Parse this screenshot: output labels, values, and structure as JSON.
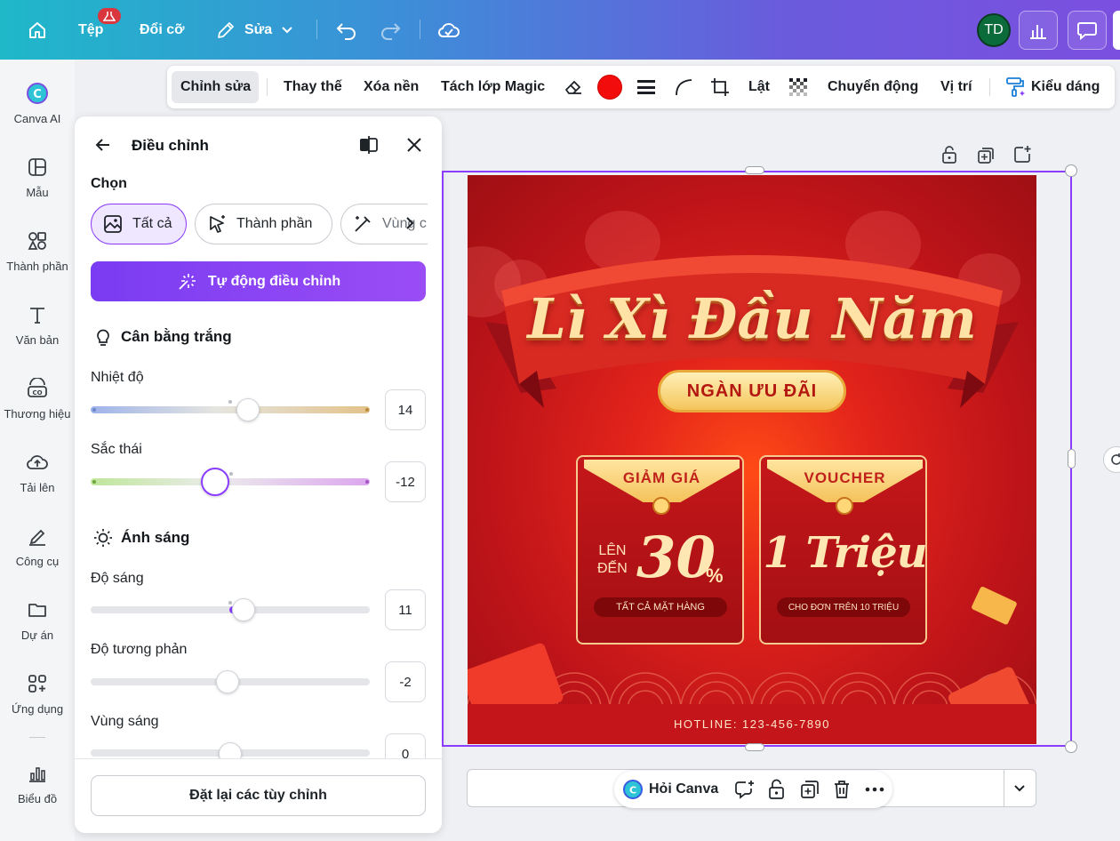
{
  "topbar": {
    "file_label": "Tệp",
    "resize_label": "Đổi cỡ",
    "edit_label": "Sửa",
    "avatar_initials": "TD"
  },
  "rail": {
    "items": [
      {
        "label": "Canva AI"
      },
      {
        "label": "Mẫu"
      },
      {
        "label": "Thành phần"
      },
      {
        "label": "Văn bản"
      },
      {
        "label": "Thương hiệu"
      },
      {
        "label": "Tải lên"
      },
      {
        "label": "Công cụ"
      },
      {
        "label": "Dự án"
      },
      {
        "label": "Ứng dụng"
      },
      {
        "label": "Biểu đồ"
      }
    ]
  },
  "toolbar": {
    "edit": "Chỉnh sửa",
    "replace": "Thay thế",
    "remove_bg": "Xóa nền",
    "magic_layers": "Tách lớp Magic",
    "color": "#f20c0c",
    "flip": "Lật",
    "animate": "Chuyển động",
    "position": "Vị trí",
    "style": "Kiểu dáng"
  },
  "panel": {
    "title": "Điều chỉnh",
    "select_label": "Chọn",
    "chips": [
      "Tất cả",
      "Thành phần",
      "Vùng c"
    ],
    "auto_button": "Tự động điều chỉnh",
    "white_balance": {
      "title": "Cân bằng trắng",
      "temperature": {
        "label": "Nhiệt độ",
        "value": "14"
      },
      "tint": {
        "label": "Sắc thái",
        "value": "-12"
      }
    },
    "light": {
      "title": "Ánh sáng",
      "brightness": {
        "label": "Độ sáng",
        "value": "11"
      },
      "contrast": {
        "label": "Độ tương phản",
        "value": "-2"
      },
      "highlights": {
        "label": "Vùng sáng",
        "value": "0"
      }
    },
    "reset_button": "Đặt lại các tùy chỉnh"
  },
  "design": {
    "headline": "Lì Xì Đầu Năm",
    "pill": "NGÀN ƯU ĐÃI",
    "card1": {
      "head": "GIẢM GIÁ",
      "prefix1": "LÊN",
      "prefix2": "ĐẾN",
      "amount": "30",
      "unit": "%",
      "foot": "TẤT CẢ MẶT HÀNG"
    },
    "card2": {
      "head": "VOUCHER",
      "amount": "1 Triệu",
      "foot": "CHO ĐƠN TRÊN 10 TRIỆU"
    },
    "hotline": "HOTLINE: 123-456-7890"
  },
  "bottom": {
    "ask_canva": "Hỏi Canva"
  }
}
